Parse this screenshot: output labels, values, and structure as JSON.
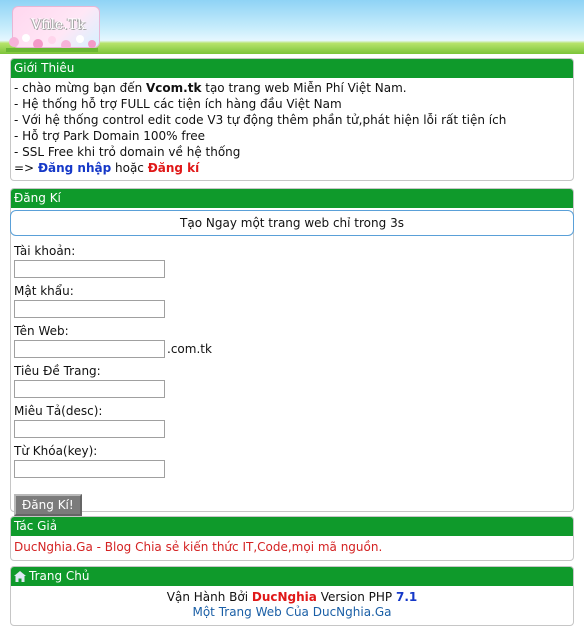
{
  "header": {
    "logo_text": "Vfile.Tk"
  },
  "intro": {
    "title": "Giới Thiêu",
    "line1_pre": "- chào mừng bạn đến ",
    "line1_brand": "Vcom.tk",
    "line1_post": " tạo trang web Miễn Phí Việt Nam.",
    "line2": "- Hệ thống hỗ trợ FULL các tiện ích hàng đầu Việt Nam",
    "line3": "- Với hệ thống control edit code V3 tự động thêm phần tử,phát hiện lỗi rất tiện ích",
    "line4": "- Hỗ trợ Park Domain 100% free",
    "line5": "- SSL Free khi trỏ domain về hệ thống",
    "arrow": "=> ",
    "login": "Đăng nhập",
    "or": " hoặc ",
    "register": "Đăng kí"
  },
  "register": {
    "title": "Đăng Kí",
    "banner": "Tạo Ngay một trang web chỉ trong 3s",
    "fields": {
      "account": "Tài khoản:",
      "password": "Mật khẩu:",
      "webname": "Tên Web:",
      "title": "Tiêu Đề Trang:",
      "desc": "Miêu Tả(desc):",
      "keywords": "Từ Khóa(key):"
    },
    "suffix": ".com.tk",
    "submit": "Đăng Kí!"
  },
  "author": {
    "title": "Tác Giả",
    "text": "DucNghia.Ga - Blog Chia sẻ kiến thức IT,Code,mọi mã nguồn."
  },
  "home": {
    "title": "Trang Chủ",
    "run_by": "Vận Hành Bởi ",
    "name": "DucNghia",
    "version_label": " Version PHP ",
    "version": "7.1",
    "link": "Một Trang Web Của DucNghia.Ga"
  },
  "colors": {
    "panel_title": "#0f9a2b",
    "brand_red": "#e01818",
    "brand_blue": "#1538c8"
  },
  "icons": [
    "home-icon",
    "flowers-decoration"
  ]
}
